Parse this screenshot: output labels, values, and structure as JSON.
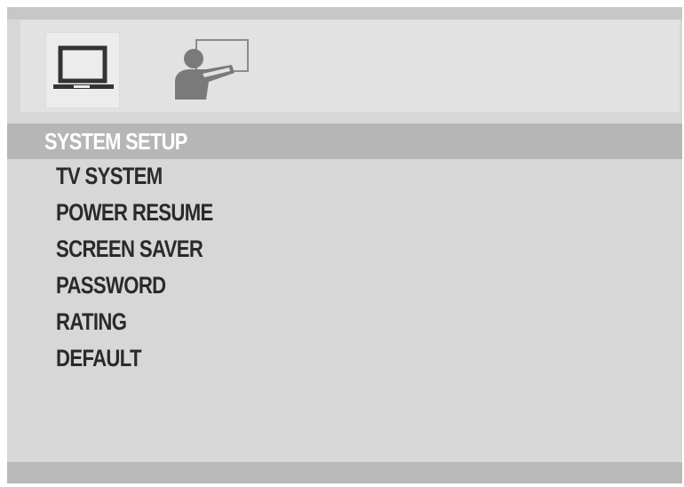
{
  "icons": {
    "setup_icon": "laptop-icon",
    "user_icon": "user-presentation-icon"
  },
  "header": {
    "title": "SYSTEM SETUP"
  },
  "menu": {
    "items": [
      {
        "label": "TV SYSTEM"
      },
      {
        "label": "POWER RESUME"
      },
      {
        "label": "SCREEN SAVER"
      },
      {
        "label": "PASSWORD"
      },
      {
        "label": "RATING"
      },
      {
        "label": "DEFAULT"
      }
    ]
  },
  "colors": {
    "panel_background": "#d7d7d7",
    "header_background": "#b6b6b6",
    "header_text": "#ffffff",
    "menu_text": "#2a2a2a",
    "icon_dark": "#333333",
    "icon_gray": "#7a7a7a"
  }
}
